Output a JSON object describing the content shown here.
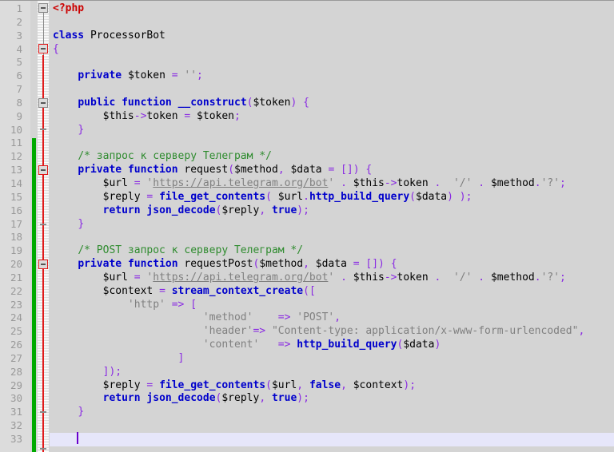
{
  "editor": {
    "language": "PHP",
    "total_lines": 33,
    "current_line": 33,
    "colors": {
      "background": "#d4d4d4",
      "gutter": "#dcdcdc",
      "keyword": "#0000cc",
      "string": "#808080",
      "comment": "#2e8b2e",
      "operator": "#8a2be2",
      "php_tag": "#cc0000",
      "current_line_highlight": "#e6e6fa",
      "caret": "#6a00cc",
      "change_bar": "#00aa00",
      "scope_line": "#e01b1b"
    },
    "line_numbers": [
      "1",
      "2",
      "3",
      "4",
      "5",
      "6",
      "7",
      "8",
      "9",
      "10",
      "11",
      "12",
      "13",
      "14",
      "15",
      "16",
      "17",
      "18",
      "19",
      "20",
      "21",
      "22",
      "23",
      "24",
      "25",
      "26",
      "27",
      "28",
      "29",
      "30",
      "31",
      "32",
      "33"
    ],
    "code_lines": [
      {
        "n": 1,
        "text": "<?php"
      },
      {
        "n": 2,
        "text": ""
      },
      {
        "n": 3,
        "text": "class ProcessorBot"
      },
      {
        "n": 4,
        "text": "{"
      },
      {
        "n": 5,
        "text": ""
      },
      {
        "n": 6,
        "text": "    private $token = '';"
      },
      {
        "n": 7,
        "text": ""
      },
      {
        "n": 8,
        "text": "    public function __construct($token) {"
      },
      {
        "n": 9,
        "text": "        $this->token = $token;"
      },
      {
        "n": 10,
        "text": "    }"
      },
      {
        "n": 11,
        "text": ""
      },
      {
        "n": 12,
        "text": "    /* запрос к серверу Телеграм */"
      },
      {
        "n": 13,
        "text": "    private function request($method, $data = []) {"
      },
      {
        "n": 14,
        "text": "        $url = 'https://api.telegram.org/bot' . $this->token .  '/' . $method.'?';"
      },
      {
        "n": 15,
        "text": "        $reply = file_get_contents( $url.http_build_query($data) );"
      },
      {
        "n": 16,
        "text": "        return json_decode($reply, true);"
      },
      {
        "n": 17,
        "text": "    }"
      },
      {
        "n": 18,
        "text": ""
      },
      {
        "n": 19,
        "text": "    /* POST запрос к серверу Телеграм */"
      },
      {
        "n": 20,
        "text": "    private function requestPost($method, $data = []) {"
      },
      {
        "n": 21,
        "text": "        $url = 'https://api.telegram.org/bot' . $this->token .  '/' . $method.'?';"
      },
      {
        "n": 22,
        "text": "        $context = stream_context_create(["
      },
      {
        "n": 23,
        "text": "            'http' => ["
      },
      {
        "n": 24,
        "text": "                        'method'    => 'POST',"
      },
      {
        "n": 25,
        "text": "                        'header'=> \"Content-type: application/x-www-form-urlencoded\","
      },
      {
        "n": 26,
        "text": "                        'content'   => http_build_query($data)"
      },
      {
        "n": 27,
        "text": "                    ]"
      },
      {
        "n": 28,
        "text": "        ]);"
      },
      {
        "n": 29,
        "text": "        $reply = file_get_contents($url, false, $context);"
      },
      {
        "n": 30,
        "text": "        return json_decode($reply, true);"
      },
      {
        "n": 31,
        "text": "    }"
      },
      {
        "n": 32,
        "text": ""
      },
      {
        "n": 33,
        "text": ""
      }
    ],
    "tokens": {
      "php_open": "<?php",
      "kw_class": "class",
      "class_name": "ProcessorBot",
      "kw_private": "private",
      "kw_public": "public",
      "kw_function": "function",
      "kw_return": "return",
      "var_token": "$token",
      "var_this": "$this",
      "var_url": "$url",
      "var_reply": "$reply",
      "var_data": "$data",
      "var_method": "$method",
      "var_context": "$context",
      "method_construct": "__construct",
      "method_request": "request",
      "method_request_post": "requestPost",
      "fn_file_get_contents": "file_get_contents",
      "fn_http_build_query": "http_build_query",
      "fn_json_decode": "json_decode",
      "fn_stream_context_create": "stream_context_create",
      "literal_true": "true",
      "literal_false": "false",
      "str_empty": "''",
      "str_url": "https://api.telegram.org/bot",
      "str_slash": "'/'",
      "str_qmark": "'?'",
      "str_http_key": "'http'",
      "str_method_key": "'method'",
      "str_header_key": "'header'",
      "str_content_key": "'content'",
      "str_post": "'POST'",
      "str_content_type": "\"Content-type: application/x-www-form-urlencoded\"",
      "comment_request": "/* запрос к серверу Телеграм */",
      "comment_request_post": "/* POST запрос к серверу Телеграм */"
    }
  }
}
